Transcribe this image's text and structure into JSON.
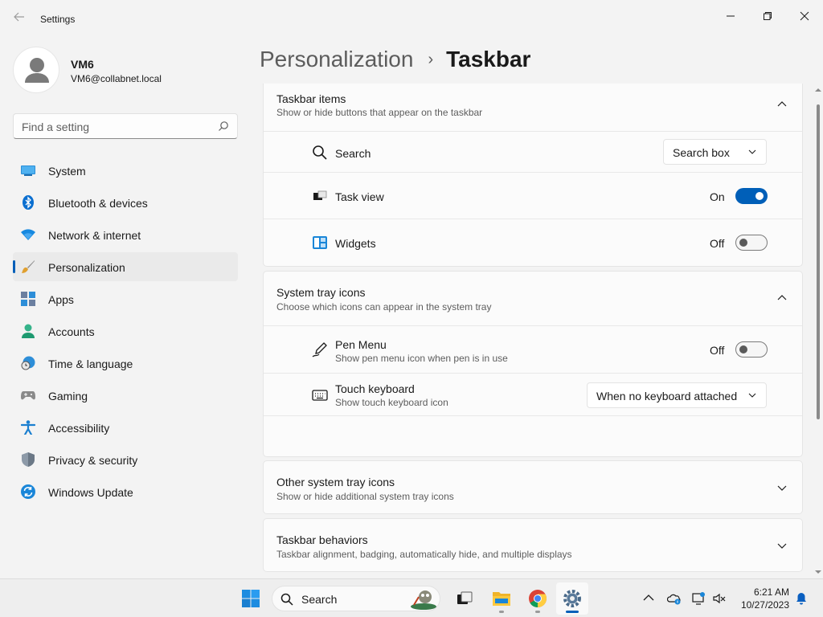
{
  "window": {
    "title": "Settings",
    "back_icon": "back-arrow-icon",
    "minimize_icon": "minimize-icon",
    "maximize_icon": "restore-icon",
    "close_icon": "close-icon"
  },
  "user": {
    "name": "VM6",
    "email": "VM6@collabnet.local"
  },
  "search": {
    "placeholder": "Find a setting"
  },
  "nav": {
    "items": [
      {
        "label": "System",
        "icon": "monitor-icon"
      },
      {
        "label": "Bluetooth & devices",
        "icon": "bluetooth-icon"
      },
      {
        "label": "Network & internet",
        "icon": "wifi-icon"
      },
      {
        "label": "Personalization",
        "icon": "paintbrush-icon",
        "selected": true
      },
      {
        "label": "Apps",
        "icon": "apps-icon"
      },
      {
        "label": "Accounts",
        "icon": "person-icon"
      },
      {
        "label": "Time & language",
        "icon": "globe-clock-icon"
      },
      {
        "label": "Gaming",
        "icon": "gamepad-icon"
      },
      {
        "label": "Accessibility",
        "icon": "accessibility-icon"
      },
      {
        "label": "Privacy & security",
        "icon": "shield-icon"
      },
      {
        "label": "Windows Update",
        "icon": "update-icon"
      }
    ]
  },
  "breadcrumb": {
    "parent": "Personalization",
    "separator": "›",
    "current": "Taskbar"
  },
  "sections": {
    "taskbar_items": {
      "title": "Taskbar items",
      "description": "Show or hide buttons that appear on the taskbar",
      "rows": {
        "search": {
          "label": "Search",
          "value": "Search box"
        },
        "task_view": {
          "label": "Task view",
          "state": "On"
        },
        "widgets": {
          "label": "Widgets",
          "state": "Off"
        }
      }
    },
    "system_tray": {
      "title": "System tray icons",
      "description": "Choose which icons can appear in the system tray",
      "rows": {
        "pen_menu": {
          "label": "Pen Menu",
          "sublabel": "Show pen menu icon when pen is in use",
          "state": "Off"
        },
        "touch_keyboard": {
          "label": "Touch keyboard",
          "sublabel": "Show touch keyboard icon",
          "value": "When no keyboard attached"
        }
      }
    },
    "other_tray": {
      "title": "Other system tray icons",
      "description": "Show or hide additional system tray icons"
    },
    "behaviors": {
      "title": "Taskbar behaviors",
      "description": "Taskbar alignment, badging, automatically hide, and multiple displays"
    }
  },
  "taskbar": {
    "search_placeholder": "Search",
    "apps": [
      "start-icon",
      "task-view-icon",
      "file-explorer-icon",
      "chrome-icon",
      "settings-icon"
    ],
    "time": "6:21 AM",
    "date": "10/27/2023"
  },
  "colors": {
    "accent": "#005fb8",
    "background": "#f3f3f3",
    "card": "#fbfbfb"
  }
}
